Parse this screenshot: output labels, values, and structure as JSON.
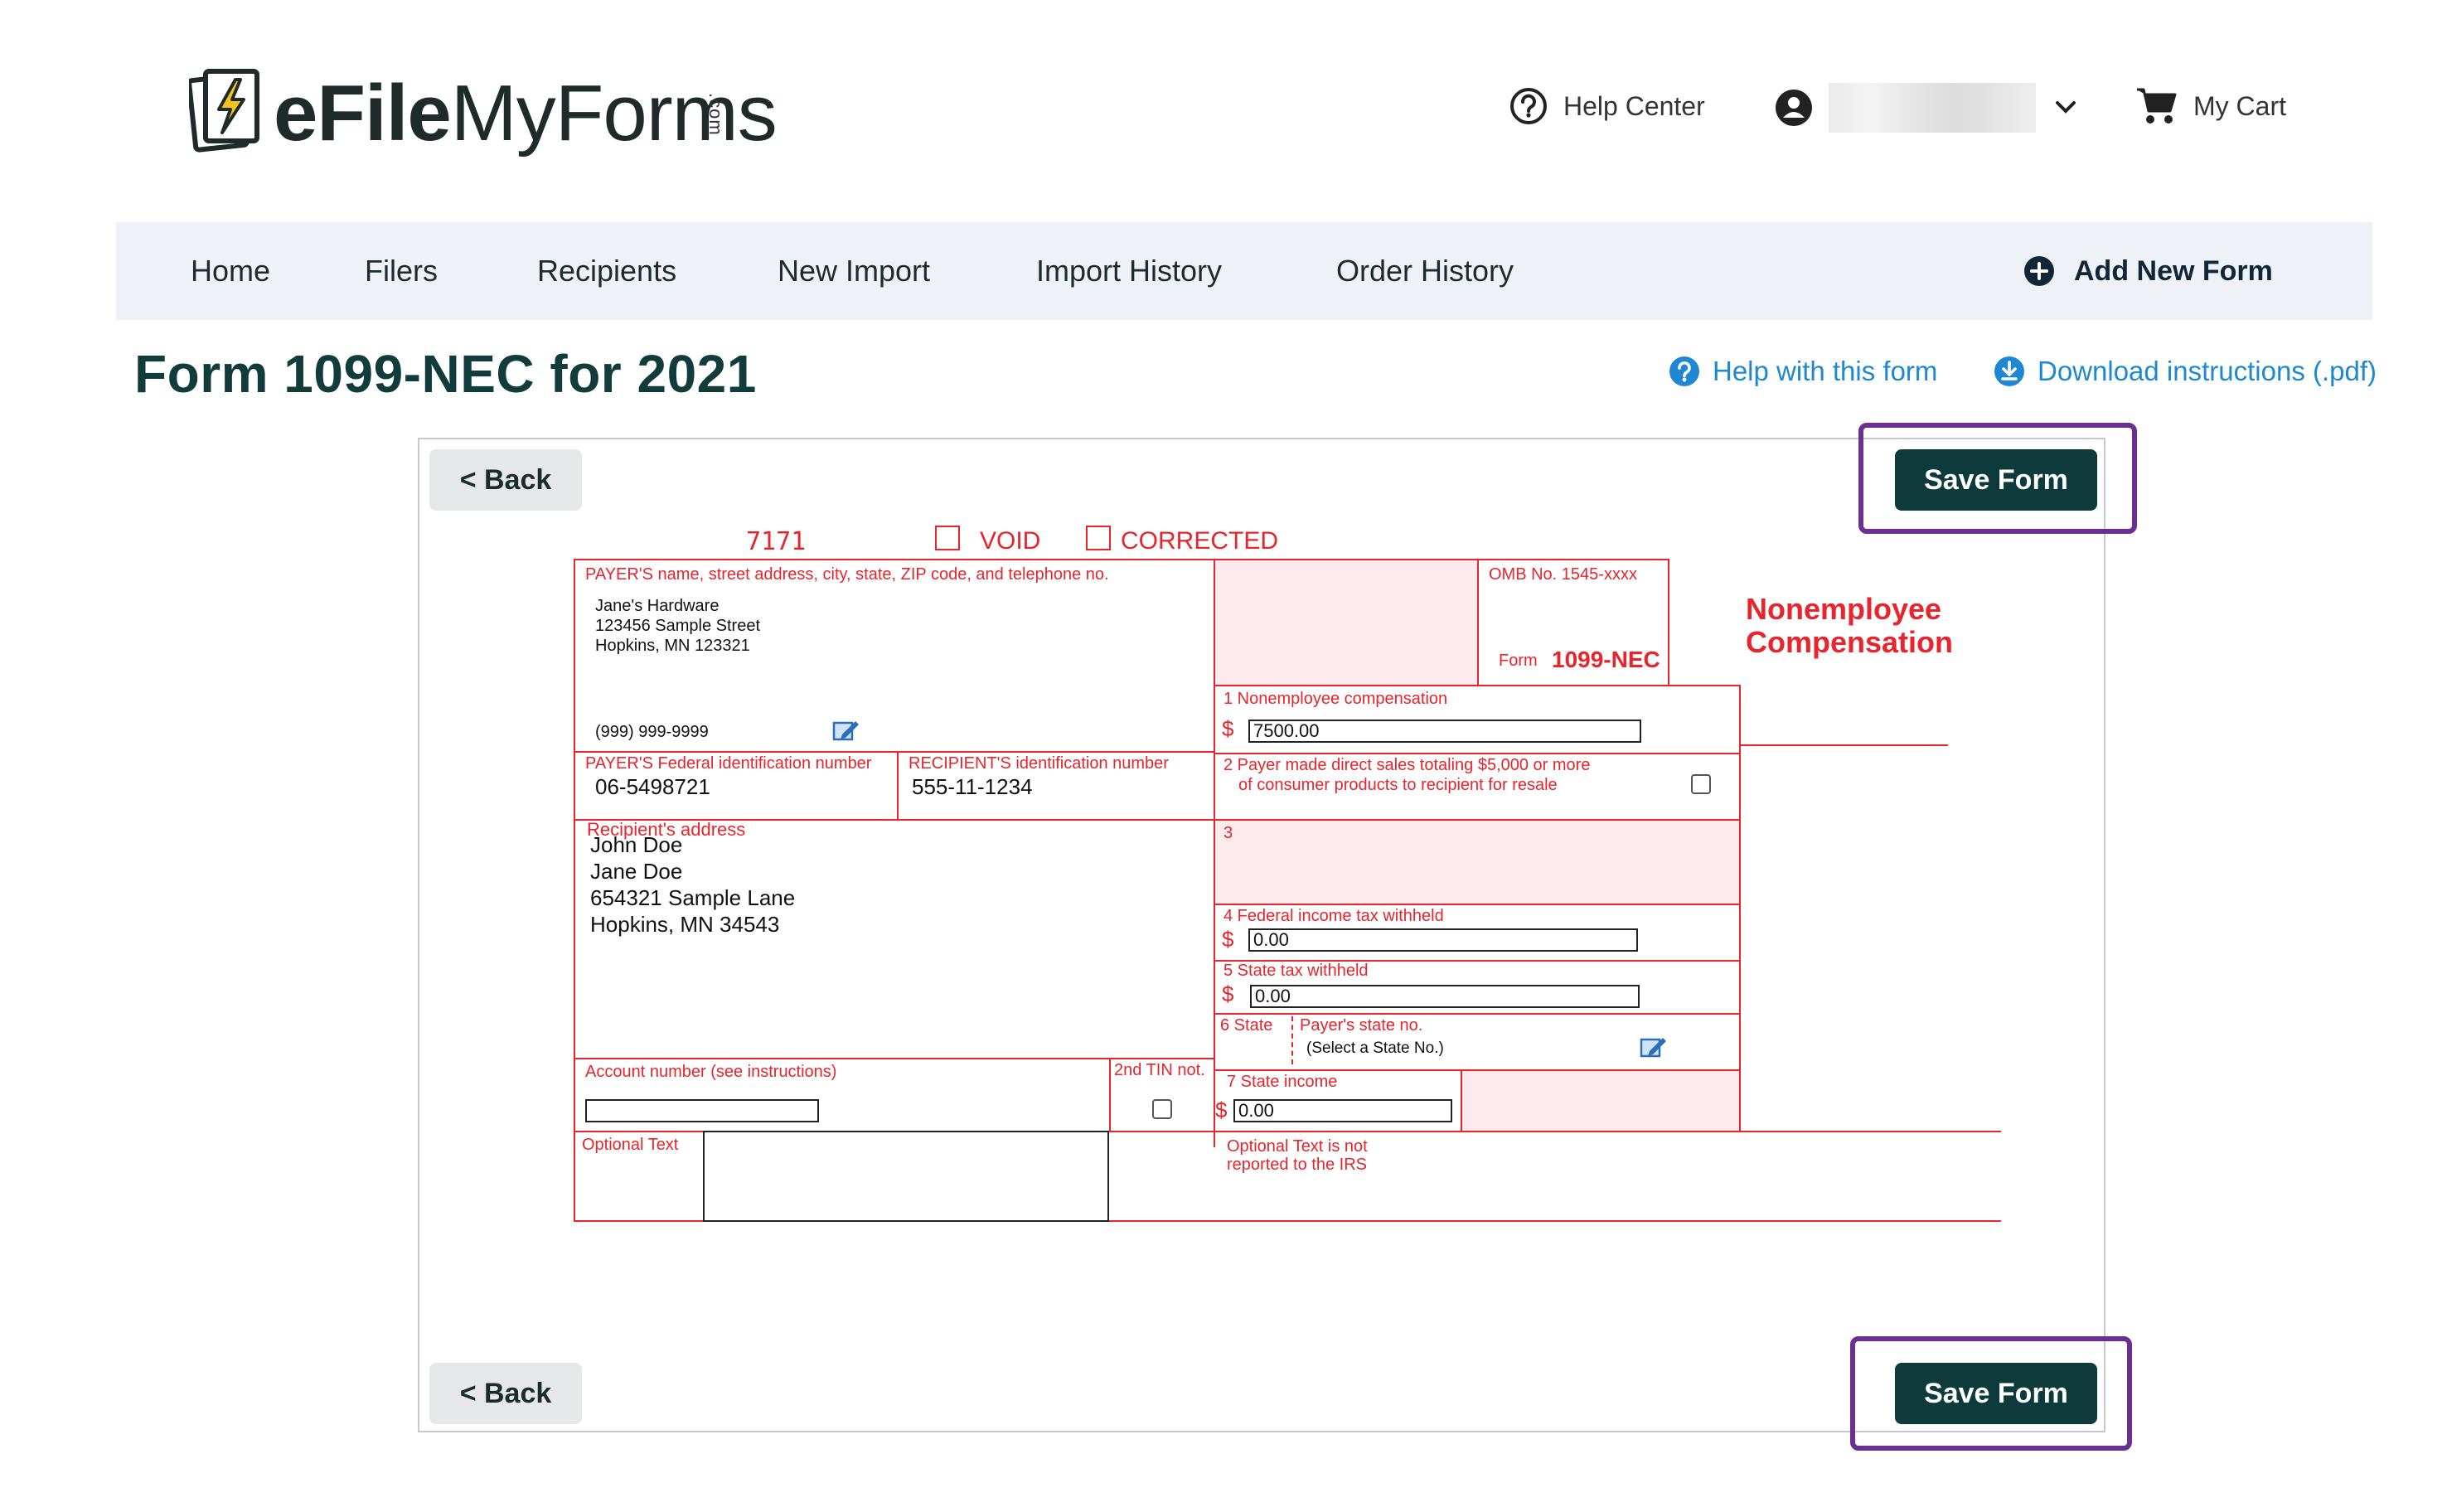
{
  "header": {
    "logo_bold": "eFile",
    "logo_light": "MyForms",
    "logo_suffix": ".com",
    "help_center": "Help Center",
    "cart": "My Cart"
  },
  "nav": {
    "items": [
      {
        "label": "Home"
      },
      {
        "label": "Filers"
      },
      {
        "label": "Recipients"
      },
      {
        "label": "New Import"
      },
      {
        "label": "Import History"
      },
      {
        "label": "Order History"
      }
    ],
    "add_new_form": "Add New Form"
  },
  "page": {
    "title": "Form 1099-NEC for 2021",
    "help_link": "Help with this form",
    "download_link": "Download instructions (.pdf)"
  },
  "buttons": {
    "back": "< Back",
    "save": "Save Form"
  },
  "form": {
    "code": "7171",
    "void": "VOID",
    "corrected": "CORRECTED",
    "omb": "OMB No. 1545-xxxx",
    "form_prefix": "Form",
    "form_name": "1099-NEC",
    "form_title_1": "Nonemployee",
    "form_title_2": "Compensation",
    "payer_label": "PAYER'S name, street address, city, state, ZIP code, and telephone no.",
    "payer_name": "Jane's Hardware",
    "payer_street": "123456 Sample Street",
    "payer_city": "Hopkins, MN 123321",
    "payer_phone": "(999) 999-9999",
    "payer_tin_label": "PAYER'S Federal identification number",
    "payer_tin": "06-5498721",
    "recipient_tin_label": "RECIPIENT'S identification number",
    "recipient_tin": "555-11-1234",
    "recipient_address_label": "Recipient's address",
    "recipient_lines": [
      "John Doe",
      "Jane Doe",
      "654321 Sample Lane",
      "Hopkins, MN 34543"
    ],
    "box1_label": "1  Nonemployee compensation",
    "box1_value": "7500.00",
    "box2_label_1": "2 Payer made direct sales totaling $5,000 or more",
    "box2_label_2": "of consumer products to recipient for resale",
    "box3_label": "3",
    "box4_label": "4  Federal income tax withheld",
    "box4_value": "0.00",
    "box5_label": "5  State tax withheld",
    "box5_value": "0.00",
    "box6_label": "6 State",
    "box6_payer_state": "Payer's state no.",
    "box6_select": "(Select a State No.)",
    "box7_label": "7  State income",
    "box7_value": "0.00",
    "account_label": "Account number (see instructions)",
    "tin_not_label": "2nd TIN not.",
    "optional_text_label": "Optional Text",
    "optional_note_1": "Optional Text is not",
    "optional_note_2": "reported to the IRS",
    "dollar": "$"
  }
}
